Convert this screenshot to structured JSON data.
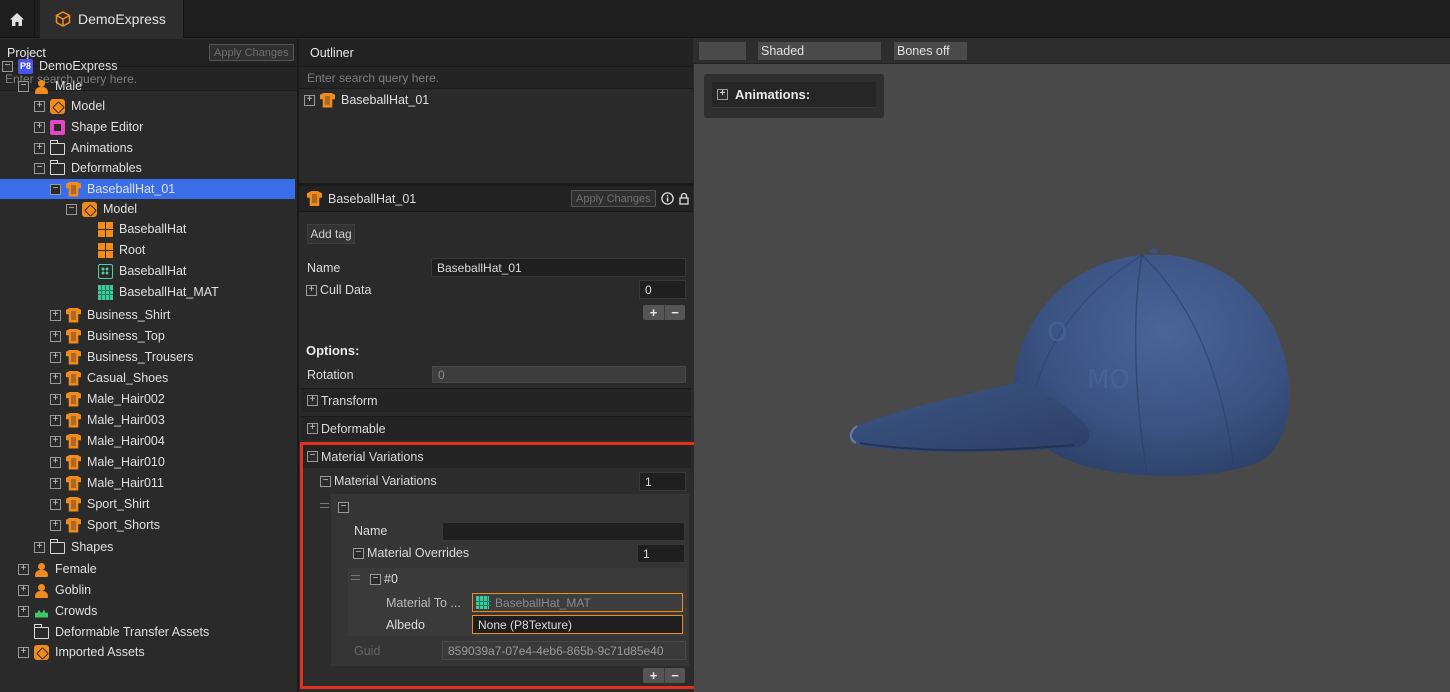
{
  "app": {
    "tab_title": "DemoExpress"
  },
  "project": {
    "header": "Project",
    "apply_label": "Apply Changes",
    "search_placeholder": "Enter search query here."
  },
  "tree": [
    {
      "label": "DemoExpress",
      "icon": "p8",
      "indent": 0,
      "expander": "minus"
    },
    {
      "label": "Male",
      "icon": "char",
      "indent": 1,
      "expander": "minus"
    },
    {
      "label": "Model",
      "icon": "model",
      "indent": 2,
      "expander": "plus"
    },
    {
      "label": "Shape Editor",
      "icon": "shape",
      "indent": 2,
      "expander": "plus"
    },
    {
      "label": "Animations",
      "icon": "folder",
      "indent": 2,
      "expander": "plus"
    },
    {
      "label": "Deformables",
      "icon": "folder",
      "indent": 2,
      "expander": "minus"
    },
    {
      "label": "BaseballHat_01",
      "icon": "shirt",
      "indent": 3,
      "expander": "minus",
      "selected": true
    },
    {
      "label": "Model",
      "icon": "model",
      "indent": 4,
      "expander": "minus"
    },
    {
      "label": "BaseballHat",
      "icon": "bones",
      "indent": 5,
      "expander": "none"
    },
    {
      "label": "Root",
      "icon": "bones",
      "indent": 5,
      "expander": "none"
    },
    {
      "label": "BaseballHat",
      "icon": "mesh",
      "indent": 5,
      "expander": "none"
    },
    {
      "label": "BaseballHat_MAT",
      "icon": "mat",
      "indent": 5,
      "expander": "none"
    },
    {
      "label": "Business_Shirt",
      "icon": "shirt",
      "indent": 3,
      "expander": "plus"
    },
    {
      "label": "Business_Top",
      "icon": "shirt",
      "indent": 3,
      "expander": "plus"
    },
    {
      "label": "Business_Trousers",
      "icon": "shirt",
      "indent": 3,
      "expander": "plus"
    },
    {
      "label": "Casual_Shoes",
      "icon": "shirt",
      "indent": 3,
      "expander": "plus"
    },
    {
      "label": "Male_Hair002",
      "icon": "shirt",
      "indent": 3,
      "expander": "plus"
    },
    {
      "label": "Male_Hair003",
      "icon": "shirt",
      "indent": 3,
      "expander": "plus"
    },
    {
      "label": "Male_Hair004",
      "icon": "shirt",
      "indent": 3,
      "expander": "plus"
    },
    {
      "label": "Male_Hair010",
      "icon": "shirt",
      "indent": 3,
      "expander": "plus"
    },
    {
      "label": "Male_Hair011",
      "icon": "shirt",
      "indent": 3,
      "expander": "plus"
    },
    {
      "label": "Sport_Shirt",
      "icon": "shirt",
      "indent": 3,
      "expander": "plus"
    },
    {
      "label": "Sport_Shorts",
      "icon": "shirt",
      "indent": 3,
      "expander": "plus"
    },
    {
      "label": "Shapes",
      "icon": "folder",
      "indent": 2,
      "expander": "plus"
    },
    {
      "label": "Female",
      "icon": "char",
      "indent": 1,
      "expander": "plus"
    },
    {
      "label": "Goblin",
      "icon": "char",
      "indent": 1,
      "expander": "plus"
    },
    {
      "label": "Crowds",
      "icon": "crowd",
      "indent": 1,
      "expander": "plus"
    },
    {
      "label": "Deformable Transfer Assets",
      "icon": "folder",
      "indent": 1,
      "expander": "none"
    },
    {
      "label": "Imported Assets",
      "icon": "model",
      "indent": 1,
      "expander": "plus"
    }
  ],
  "outliner": {
    "header": "Outliner",
    "search_placeholder": "Enter search query here.",
    "item": "BaseballHat_01"
  },
  "inspector": {
    "title": "BaseballHat_01",
    "apply_label": "Apply Changes",
    "add_tag_label": "Add tag",
    "name_label": "Name",
    "name_value": "BaseballHat_01",
    "cull_label": "Cull Data",
    "cull_value": "0",
    "options_label": "Options:",
    "rotation_label": "Rotation",
    "rotation_value": "0",
    "transform_label": "Transform",
    "deformable_label": "Deformable",
    "matvar_section_label": "Material Variations",
    "matvar_label": "Material Variations",
    "matvar_count": "1",
    "entry_name_label": "Name",
    "entry_name_value": "",
    "overrides_label": "Material Overrides",
    "overrides_count": "1",
    "override_index": "#0",
    "material_to_label": "Material To ...",
    "material_to_value": "BaseballHat_MAT",
    "albedo_label": "Albedo",
    "albedo_value": "None (P8Texture)",
    "guid_label": "Guid",
    "guid_value": "859039a7-07e4-4eb6-865b-9c71d85e40"
  },
  "viewport": {
    "shading": "Shaded",
    "bones": "Bones off",
    "animations_label": "Animations:"
  },
  "colors": {
    "accent": "#f28b1e",
    "selection": "#3a6ee8",
    "highlight": "#e0321e"
  }
}
